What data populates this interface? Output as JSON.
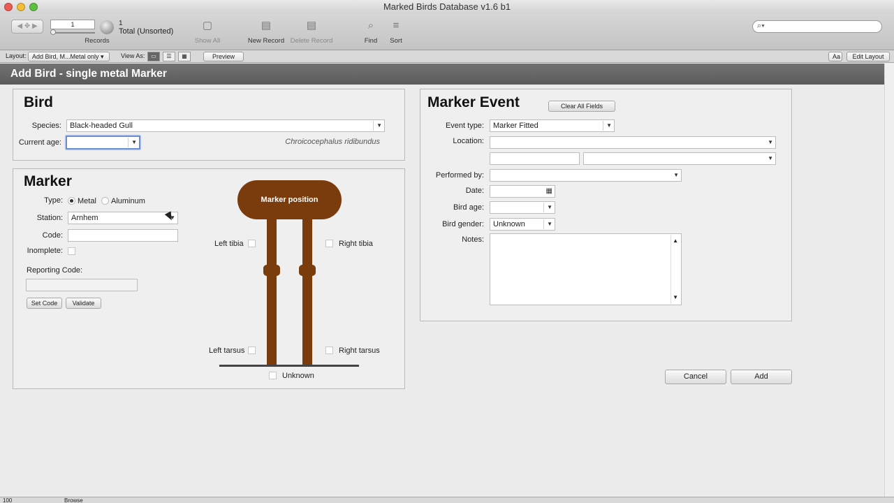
{
  "window": {
    "title": "Marked Birds Database v1.6 b1"
  },
  "toolbar": {
    "record_number": "1",
    "records_label": "Records",
    "found_count": "1",
    "total_label": "Total (Unsorted)",
    "show_all": "Show All",
    "new_record": "New Record",
    "delete_record": "Delete Record",
    "find": "Find",
    "sort": "Sort"
  },
  "layoutbar": {
    "layout_label": "Layout:",
    "layout_value": "Add Bird, M...Metal only",
    "view_as_label": "View As:",
    "preview": "Preview",
    "font_btn": "Aa",
    "edit_layout": "Edit Layout"
  },
  "header": {
    "title": "Add Bird - single metal Marker"
  },
  "bird": {
    "title": "Bird",
    "species_label": "Species:",
    "species_value": "Black-headed Gull",
    "age_label": "Current age:",
    "age_value": "",
    "scientific_name": "Chroicocephalus ridibundus"
  },
  "marker": {
    "title": "Marker",
    "type_label": "Type:",
    "type_options": [
      "Metal",
      "Aluminum"
    ],
    "type_selected": "Metal",
    "station_label": "Station:",
    "station_value": "Arnhem",
    "code_label": "Code:",
    "code_value": "",
    "incomplete_label": "Inomplete:",
    "reporting_code_label": "Reporting Code:",
    "set_code": "Set Code",
    "validate": "Validate",
    "diagram": {
      "title": "Marker position",
      "left_tibia": "Left tibia",
      "right_tibia": "Right tibia",
      "left_tarsus": "Left tarsus",
      "right_tarsus": "Right tarsus",
      "unknown": "Unknown",
      "color": "#7a3c0c"
    }
  },
  "event": {
    "title": "Marker Event",
    "clear_all": "Clear All Fields",
    "event_type_label": "Event type:",
    "event_type_value": "Marker Fitted",
    "location_label": "Location:",
    "performed_by_label": "Performed by:",
    "date_label": "Date:",
    "bird_age_label": "Bird age:",
    "bird_gender_label": "Bird gender:",
    "bird_gender_value": "Unknown",
    "notes_label": "Notes:"
  },
  "actions": {
    "cancel": "Cancel",
    "add": "Add"
  },
  "statusbar": {
    "zoom": "100",
    "mode": "Browse"
  }
}
